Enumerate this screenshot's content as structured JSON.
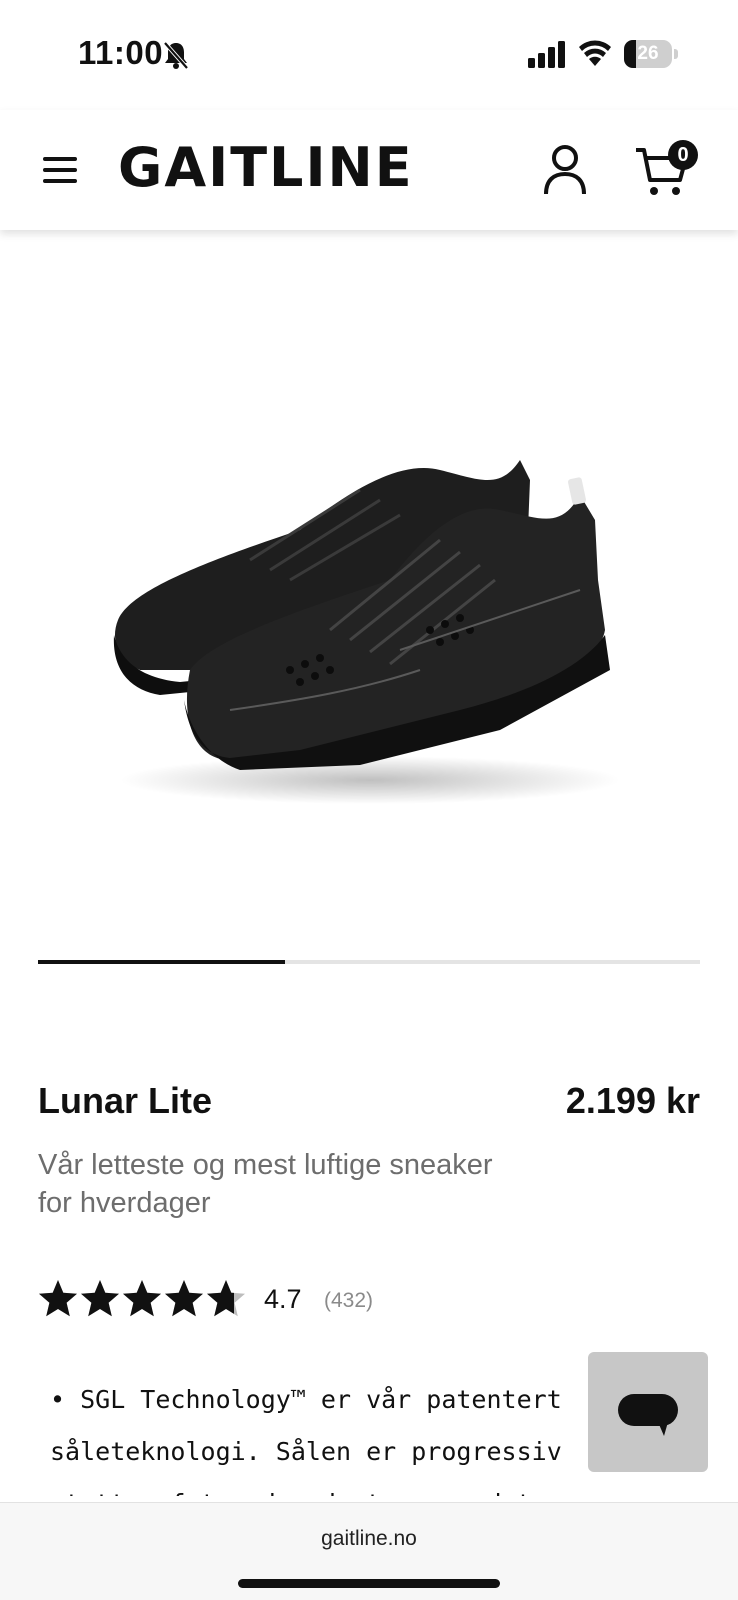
{
  "status_bar": {
    "time": "11:00",
    "battery_level": 26,
    "battery_text": "26",
    "icons": [
      "bell-off-icon",
      "cellular-signal-icon",
      "wifi-icon",
      "battery-icon"
    ]
  },
  "header": {
    "logo": "GAITLINE",
    "menu_icon": "hamburger-menu-icon",
    "account_icon": "person-icon",
    "cart_icon": "shopping-cart-icon",
    "cart_count": "0"
  },
  "carousel": {
    "current_slide": 1,
    "progress_fraction": 0.373
  },
  "product": {
    "name": "Lunar Lite",
    "price": "2.199 kr",
    "subtitle_line1": "Vår letteste og mest luftige sneaker",
    "subtitle_line2": "for hverdager",
    "rating": "4.7",
    "rating_value": 4.7,
    "rating_max": 5,
    "review_count": "(432)",
    "description_line1": "• SGL Technology™ er vår patentert",
    "description_line2": "såleteknologi. Sålen er progressiv",
    "description_line3": "støtter foten der du trenger det, og"
  },
  "chat": {
    "icon": "chat-bubble-icon"
  },
  "browser": {
    "url": "gaitline.no"
  },
  "colors": {
    "text": "#111111",
    "subtitle": "#6d6d6d",
    "star_filled": "#111111",
    "star_empty": "#bdbdbd",
    "chat_bg": "#c7c7c7"
  }
}
